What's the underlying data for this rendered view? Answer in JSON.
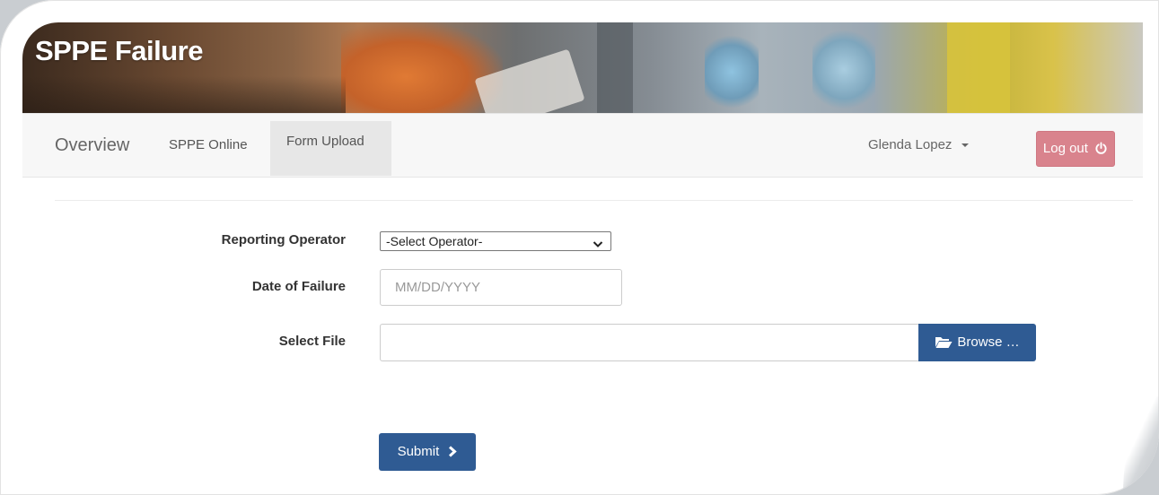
{
  "header": {
    "title": "SPPE Failure"
  },
  "nav": {
    "brand": "Overview",
    "links": [
      "SPPE Online",
      "Form Upload"
    ],
    "active": "Form Upload",
    "user": "Glenda Lopez",
    "logout_label": "Log out"
  },
  "form": {
    "operator_label": "Reporting Operator",
    "operator_selected": "-Select Operator-",
    "date_label": "Date of Failure",
    "date_placeholder": "MM/DD/YYYY",
    "file_label": "Select File",
    "browse_label": "Browse …",
    "submit_label": "Submit"
  },
  "colors": {
    "primary": "#2f5b93",
    "logout": "#d9838d",
    "navbar_bg": "#f7f7f7"
  },
  "icons": {
    "user_menu": "caret-down-icon",
    "logout": "power-icon",
    "browse": "folder-open-icon",
    "submit": "chevron-right-icon",
    "select": "chevron-down-icon"
  }
}
